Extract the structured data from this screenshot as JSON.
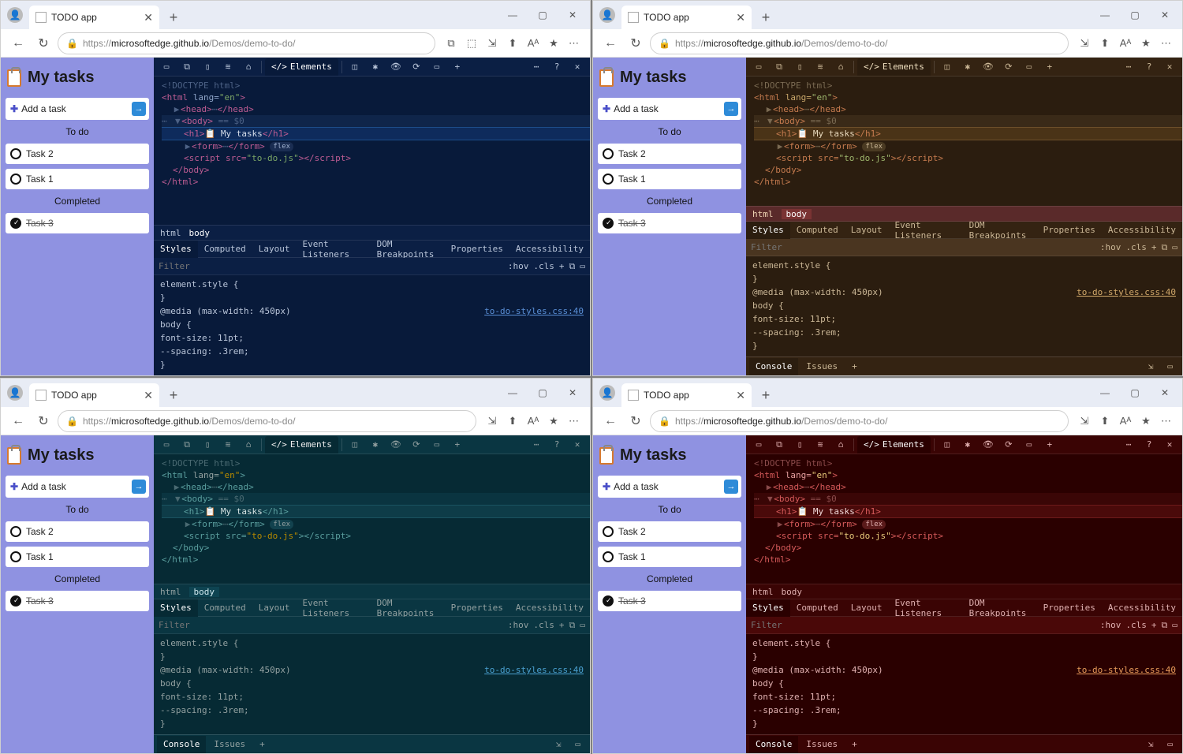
{
  "browser": {
    "tab_title": "TODO app",
    "url_prefix": "https://",
    "url_host": "microsoftedge.github.io",
    "url_path": "/Demos/demo-to-do/",
    "add_tab": "+",
    "window_controls": {
      "min": "—",
      "max": "▢",
      "close": "✕"
    },
    "nav": {
      "back": "←",
      "forward": "→",
      "refresh": "↻"
    },
    "lock": "🔒",
    "addr_icons": [
      "⧉",
      "⬚",
      "⇲",
      "⬆",
      "Aᴬ",
      "★",
      "⋯"
    ],
    "addr_icons_short": [
      "⇲",
      "⬆",
      "Aᴬ",
      "★",
      "⋯"
    ]
  },
  "todo": {
    "title": "My tasks",
    "add_placeholder": "Add a task",
    "go": "→",
    "section_todo": "To do",
    "section_done": "Completed",
    "tasks_open": [
      "Task 2",
      "Task 1"
    ],
    "tasks_done": [
      "Task 3"
    ]
  },
  "devtools": {
    "top_tools": [
      "▭",
      "⧉",
      "▯",
      "≋",
      "⌂"
    ],
    "top_tab_elements": "Elements",
    "top_tools2": [
      "◫",
      "✱",
      "👁",
      "⟳",
      "▭",
      "+"
    ],
    "top_right": [
      "⋯",
      "?",
      "✕"
    ],
    "breadcrumb": [
      "html",
      "body"
    ],
    "panels": [
      "Styles",
      "Computed",
      "Layout",
      "Event Listeners",
      "DOM Breakpoints",
      "Properties",
      "Accessibility"
    ],
    "filter_placeholder": "Filter",
    "filter_btns": [
      ":hov",
      ".cls",
      "+",
      "⧉",
      "▭"
    ],
    "css": {
      "rule1": "element.style {",
      "rule1_close": "}",
      "rule2": "@media (max-width: 450px)",
      "rule3_sel": "body {",
      "rule3_p1": "  font-size: 11pt;",
      "rule3_p2": "  --spacing: .3rem;",
      "rule3_close": "}",
      "link": "to-do-styles.css:40"
    },
    "drawer": [
      "Console",
      "Issues",
      "+"
    ],
    "drawer_right": [
      "⇲",
      "▭"
    ],
    "dom": {
      "doctype": "<!DOCTYPE html>",
      "html_open_1": "<",
      "html_open_tag": "html",
      "html_open_2": " lang=",
      "html_open_val": "\"en\"",
      "html_open_3": ">",
      "head_open": "<head>",
      "head_dots": "⋯",
      "head_close": "</head>",
      "body_open": "<body>",
      "body_eq": " == $0",
      "h1_open": "<h1>",
      "h1_icon": "📋",
      "h1_text": " My tasks",
      "h1_close": "</h1>",
      "form_open": "<form>",
      "form_dots": "⋯",
      "form_close": "</form>",
      "form_badge": "flex",
      "script_open": "<script src=",
      "script_val": "\"to-do.js\"",
      "script_mid": ">",
      "script_close2": "</script>",
      "body_close": "</body>",
      "html_close": "</html>"
    }
  },
  "panes": [
    {
      "theme": "theme-abyss",
      "show_drawer": false,
      "long_addr": true
    },
    {
      "theme": "theme-kimbie",
      "show_drawer": true,
      "long_addr": false
    },
    {
      "theme": "theme-solar",
      "show_drawer": true,
      "long_addr": false
    },
    {
      "theme": "theme-red",
      "show_drawer": true,
      "long_addr": false
    }
  ]
}
